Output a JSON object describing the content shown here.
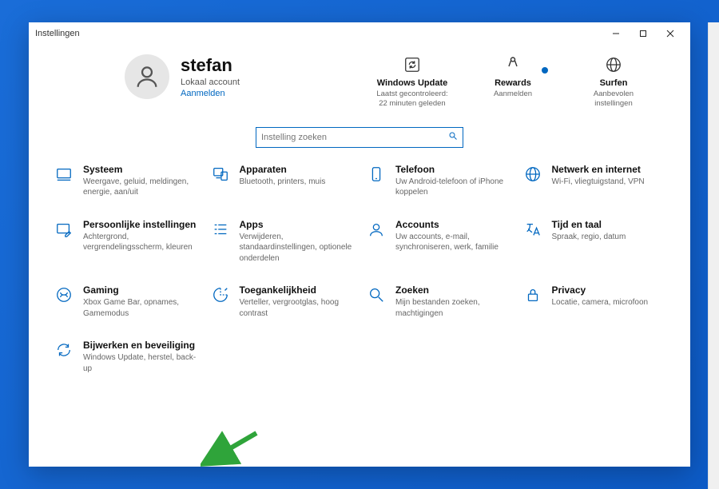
{
  "window": {
    "title": "Instellingen"
  },
  "user": {
    "name": "stefan",
    "account_type": "Lokaal account",
    "signin": "Aanmelden"
  },
  "top_cards": {
    "update": {
      "title": "Windows Update",
      "sub": "Laatst gecontroleerd: 22 minuten geleden"
    },
    "rewards": {
      "title": "Rewards",
      "sub": "Aanmelden"
    },
    "browse": {
      "title": "Surfen",
      "sub": "Aanbevolen instellingen"
    }
  },
  "search": {
    "placeholder": "Instelling zoeken"
  },
  "categories": [
    {
      "title": "Systeem",
      "desc": "Weergave, geluid, meldingen, energie, aan/uit"
    },
    {
      "title": "Apparaten",
      "desc": "Bluetooth, printers, muis"
    },
    {
      "title": "Telefoon",
      "desc": "Uw Android-telefoon of iPhone koppelen"
    },
    {
      "title": "Netwerk en internet",
      "desc": "Wi-Fi, vliegtuigstand, VPN"
    },
    {
      "title": "Persoonlijke instellingen",
      "desc": "Achtergrond, vergrendelingsscherm, kleuren"
    },
    {
      "title": "Apps",
      "desc": "Verwijderen, standaardinstellingen, optionele onderdelen"
    },
    {
      "title": "Accounts",
      "desc": "Uw accounts, e-mail, synchroniseren, werk, familie"
    },
    {
      "title": "Tijd en taal",
      "desc": "Spraak, regio, datum"
    },
    {
      "title": "Gaming",
      "desc": "Xbox Game Bar, opnames, Gamemodus"
    },
    {
      "title": "Toegankelijkheid",
      "desc": "Verteller, vergrootglas, hoog contrast"
    },
    {
      "title": "Zoeken",
      "desc": "Mijn bestanden zoeken, machtigingen"
    },
    {
      "title": "Privacy",
      "desc": "Locatie, camera, microfoon"
    },
    {
      "title": "Bijwerken en beveiliging",
      "desc": "Windows Update, herstel, back-up"
    }
  ]
}
